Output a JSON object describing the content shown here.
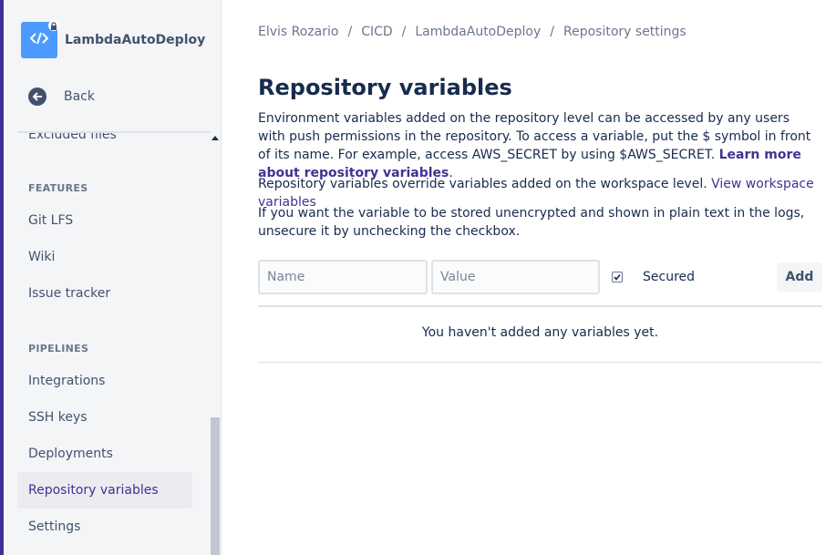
{
  "sidebar": {
    "repo_name": "LambdaAutoDeploy",
    "back_label": "Back",
    "partial_item": "Excluded files",
    "sections": [
      {
        "title": "FEATURES",
        "items": [
          "Git LFS",
          "Wiki",
          "Issue tracker"
        ]
      },
      {
        "title": "PIPELINES",
        "items": [
          "Integrations",
          "SSH keys",
          "Deployments",
          "Repository variables",
          "Settings"
        ]
      }
    ],
    "active_item": "Repository variables"
  },
  "breadcrumb": [
    "Elvis Rozario",
    "CICD",
    "LambdaAutoDeploy",
    "Repository settings"
  ],
  "breadcrumb_separator": "/",
  "page": {
    "title": "Repository variables",
    "intro_text": "Environment variables added on the repository level can be accessed by any users with push permissions in the repository. To access a variable, put the $ symbol in front of its name. For example, access AWS_SECRET by using $AWS_SECRET.",
    "intro_link": "Learn more about repository variables",
    "override_text": "Repository variables override variables added on the workspace level.",
    "override_link": "View workspace variables",
    "unsecure_text": "If you want the variable to be stored unencrypted and shown in plain text in the logs, unsecure it by unchecking the checkbox."
  },
  "form": {
    "name_placeholder": "Name",
    "value_placeholder": "Value",
    "secured_label": "Secured",
    "secured_checked": true,
    "add_label": "Add"
  },
  "table": {
    "empty_message": "You haven't added any variables yet."
  },
  "colors": {
    "accent": "#403294",
    "avatar": "#4c9aff",
    "sidebar_bg": "#f4f5f7",
    "text": "#172b4d"
  }
}
